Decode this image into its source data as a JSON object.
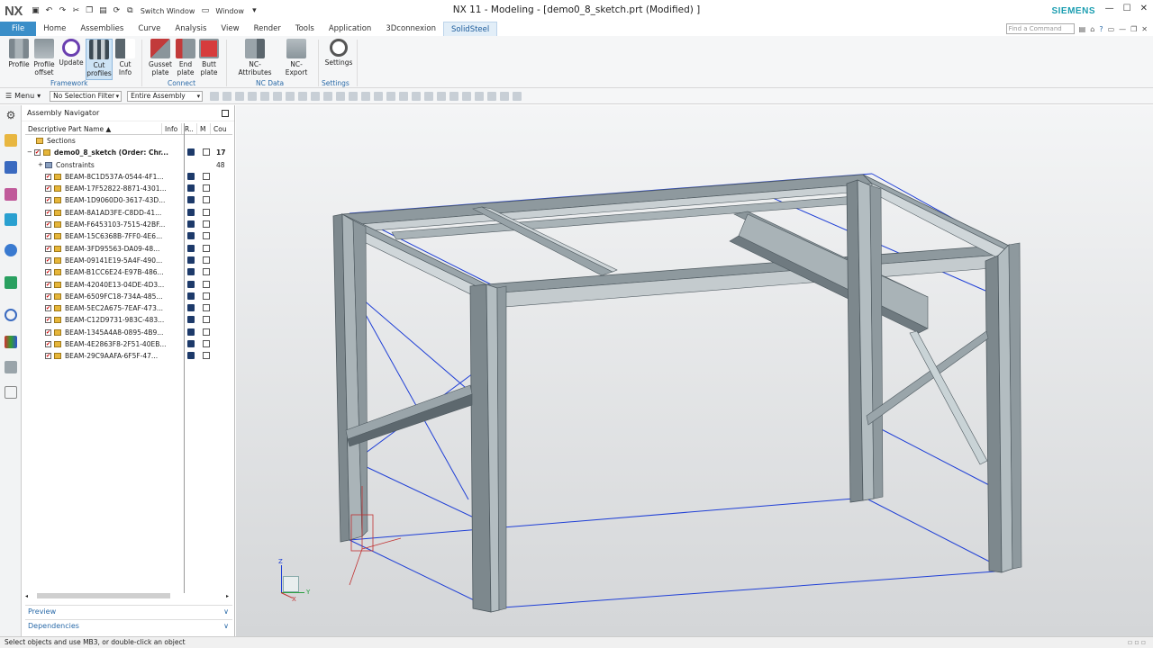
{
  "app": {
    "logo": "NX",
    "title": "NX 11 - Modeling - [demo0_8_sketch.prt (Modified) ]",
    "brand": "SIEMENS"
  },
  "quick_access": {
    "switch_window": "Switch Window",
    "window": "Window"
  },
  "tabs": [
    {
      "label": "File"
    },
    {
      "label": "Home"
    },
    {
      "label": "Assemblies"
    },
    {
      "label": "Curve"
    },
    {
      "label": "Analysis"
    },
    {
      "label": "View"
    },
    {
      "label": "Render"
    },
    {
      "label": "Tools"
    },
    {
      "label": "Application"
    },
    {
      "label": "3Dconnexion"
    },
    {
      "label": "SolidSteel"
    }
  ],
  "find_placeholder": "Find a Command",
  "ribbon": {
    "buttons": [
      {
        "l1": "Profile",
        "l2": ""
      },
      {
        "l1": "Profile",
        "l2": "offset"
      },
      {
        "l1": "Update",
        "l2": ""
      },
      {
        "l1": "Cut",
        "l2": "profiles"
      },
      {
        "l1": "Cut",
        "l2": "Info"
      },
      {
        "l1": "Gusset",
        "l2": "plate"
      },
      {
        "l1": "End",
        "l2": "plate"
      },
      {
        "l1": "Butt",
        "l2": "plate"
      },
      {
        "l1": "NC-Attributes",
        "l2": ""
      },
      {
        "l1": "NC-Export",
        "l2": ""
      },
      {
        "l1": "Settings",
        "l2": ""
      }
    ],
    "groups": {
      "framework": "Framework",
      "connect": "Connect",
      "nc_data": "NC Data",
      "settings": "Settings"
    }
  },
  "toolbar": {
    "menu": "Menu",
    "selection_filter": "No Selection Filter",
    "scope": "Entire Assembly"
  },
  "navigator": {
    "title": "Assembly Navigator",
    "columns": {
      "name": "Descriptive Part Name",
      "info": "Info",
      "r": "R..",
      "m": "M",
      "count": "Cou"
    },
    "sections": "Sections",
    "root": {
      "name": "demo0_8_sketch (Order: Chr...",
      "count": "17"
    },
    "constraints": {
      "name": "Constraints",
      "count": "48"
    },
    "beams": [
      "BEAM-8C1D537A-0544-4F1...",
      "BEAM-17F52822-8871-4301...",
      "BEAM-1D9060D0-3617-43D...",
      "BEAM-8A1AD3FE-C8DD-41...",
      "BEAM-F6453103-7515-42BF...",
      "BEAM-15C6368B-7FF0-4E6...",
      "BEAM-3FD95563-DA09-48...",
      "BEAM-09141E19-5A4F-490...",
      "BEAM-B1CC6E24-E97B-486...",
      "BEAM-42040E13-04DE-4D3...",
      "BEAM-6509FC18-734A-485...",
      "BEAM-5EC2A675-7EAF-473...",
      "BEAM-C12D9731-983C-483...",
      "BEAM-1345A4A8-0895-4B9...",
      "BEAM-4E2863F8-2F51-40EB...",
      "BEAM-29C9AAFA-6F5F-47..."
    ],
    "preview": "Preview",
    "dependencies": "Dependencies"
  },
  "triad": {
    "x": "X",
    "y": "Y",
    "z": "Z"
  },
  "status": "Select objects and use MB3, or double-click an object",
  "colors": {
    "accent": "#3a8ec8",
    "sketch": "#1f3fd6",
    "steel": "#7f8b90",
    "brand": "#1a9db0"
  }
}
